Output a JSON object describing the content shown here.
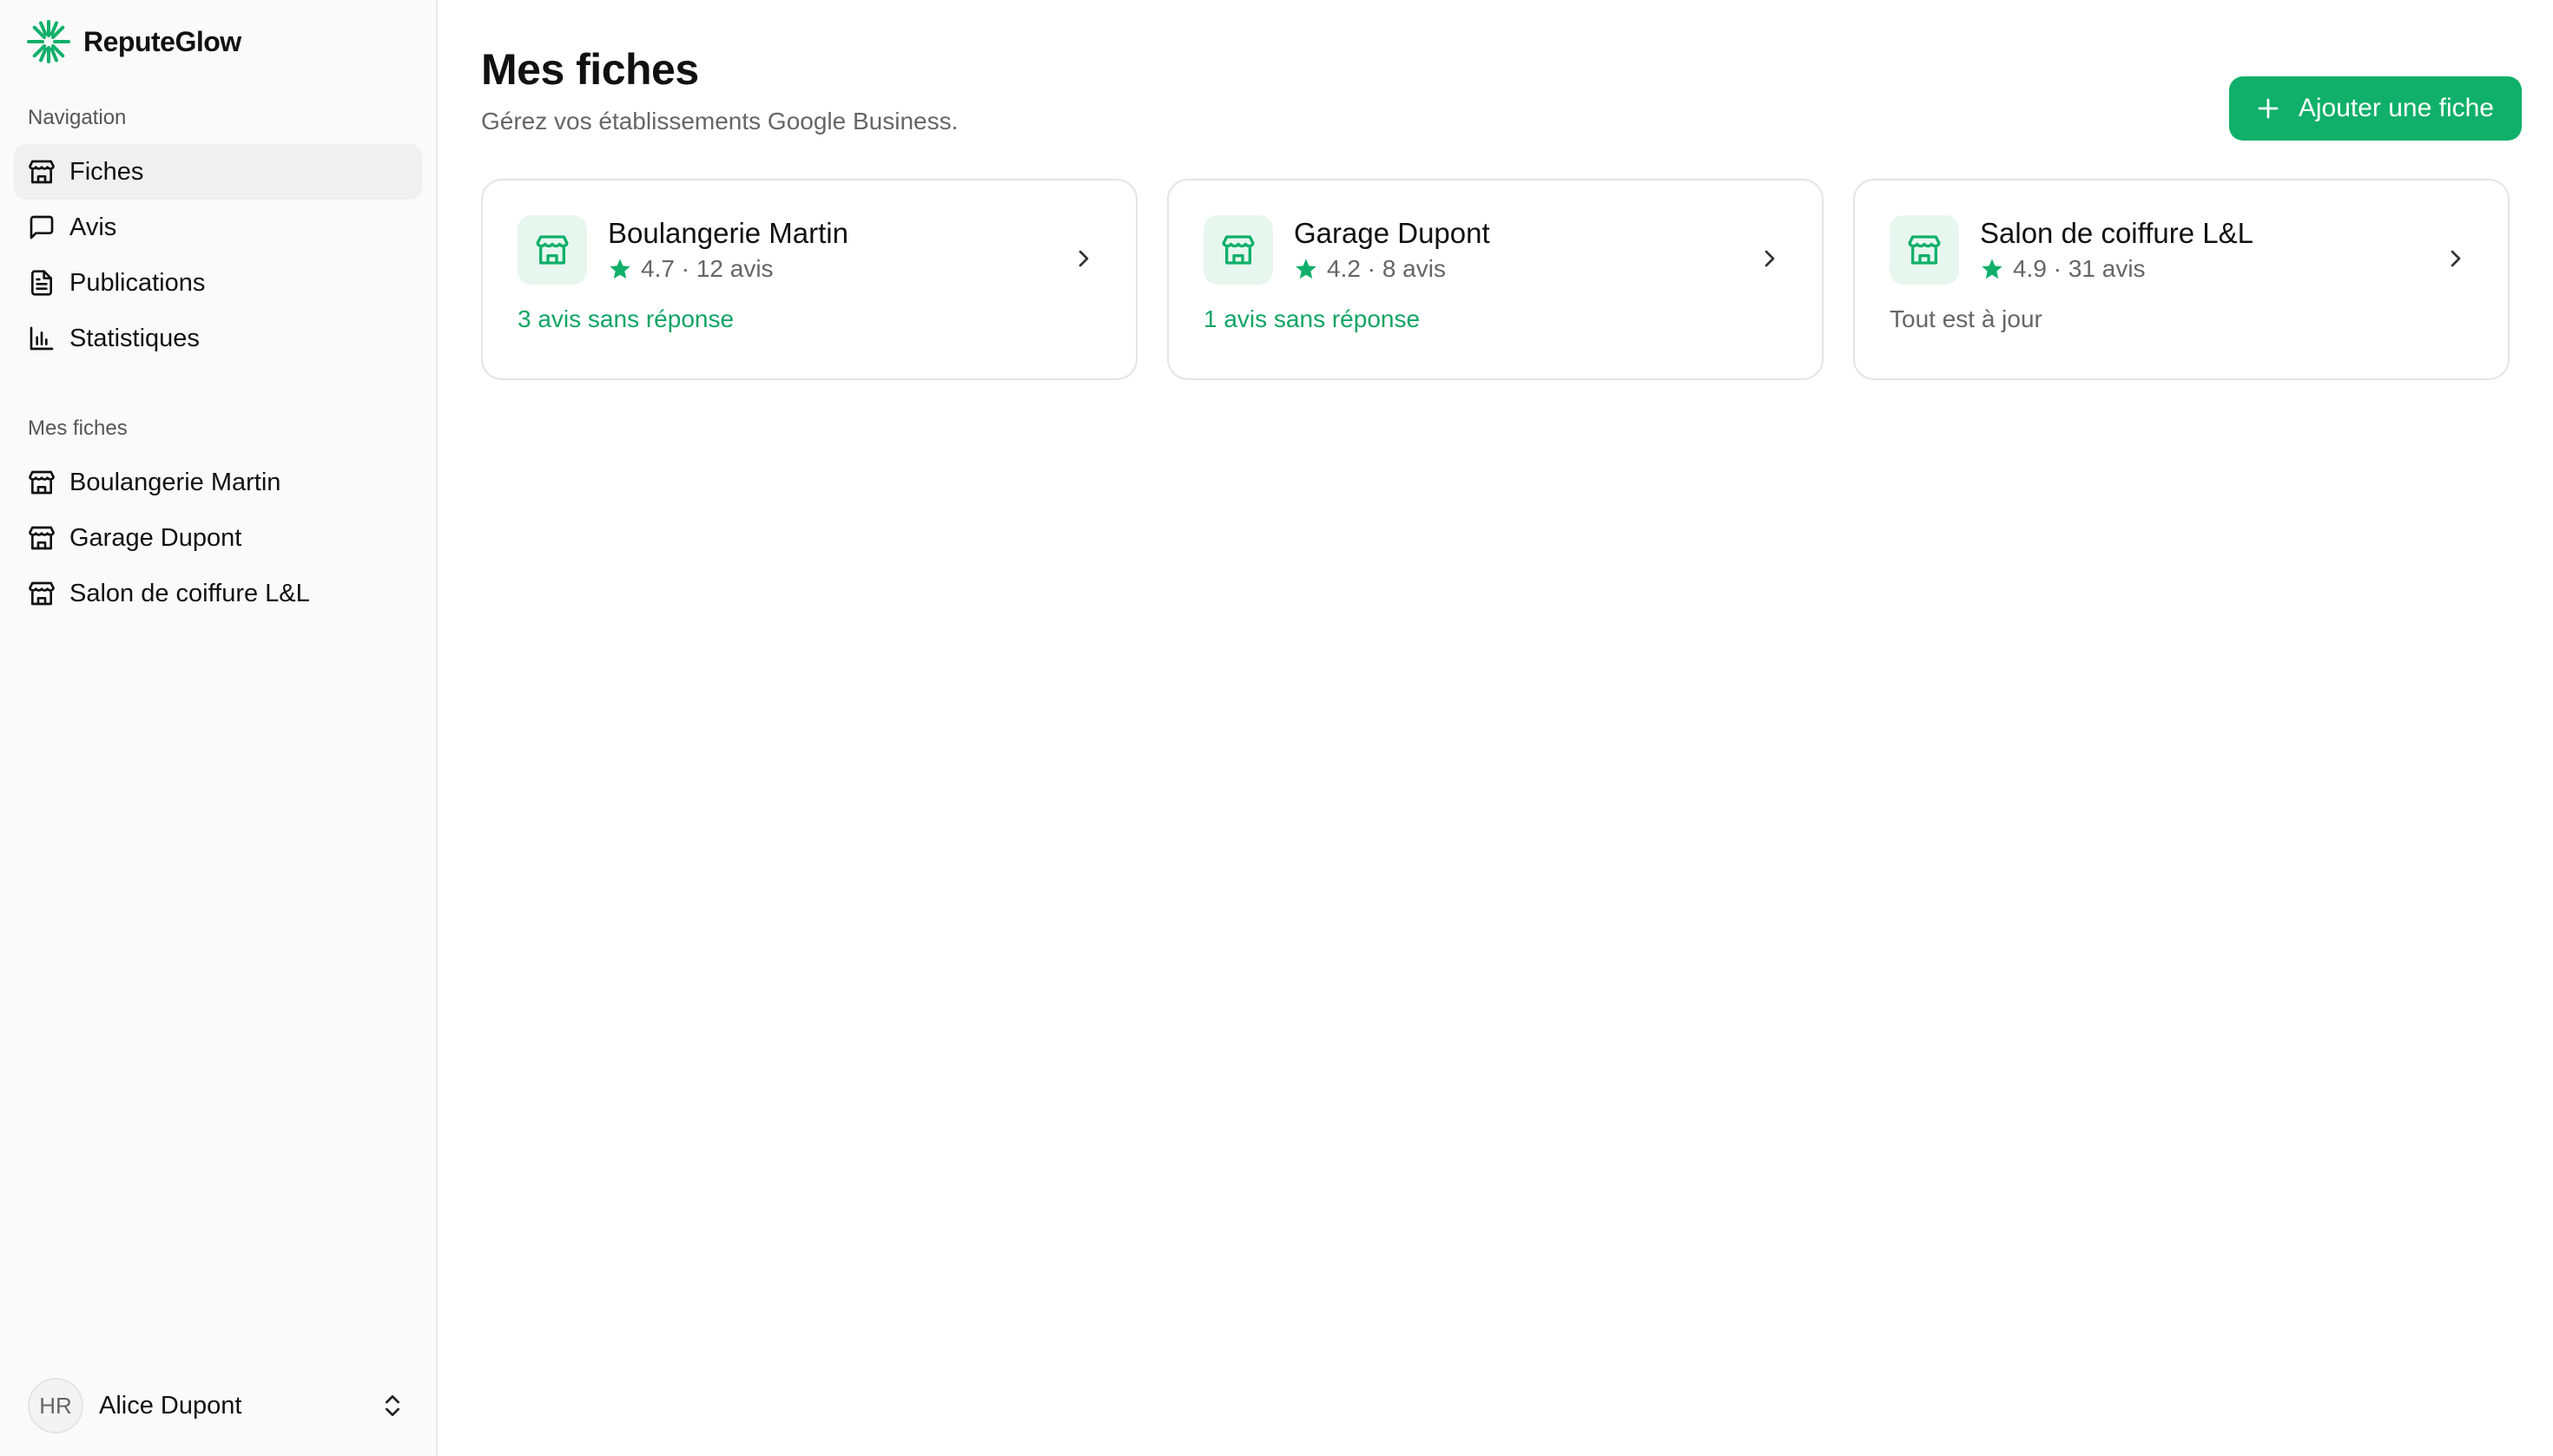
{
  "brand": {
    "name": "ReputeGlow",
    "accent": "#10b06a"
  },
  "sidebar": {
    "nav_label": "Navigation",
    "nav_items": [
      {
        "label": "Fiches",
        "icon": "store-icon",
        "active": true
      },
      {
        "label": "Avis",
        "icon": "message-square-icon",
        "active": false
      },
      {
        "label": "Publications",
        "icon": "file-text-icon",
        "active": false
      },
      {
        "label": "Statistiques",
        "icon": "bar-chart-icon",
        "active": false
      }
    ],
    "fiches_label": "Mes fiches",
    "fiches_items": [
      {
        "label": "Boulangerie Martin",
        "icon": "store-icon"
      },
      {
        "label": "Garage Dupont",
        "icon": "store-icon"
      },
      {
        "label": "Salon de coiffure L&L",
        "icon": "store-icon"
      }
    ],
    "user": {
      "initials": "HR",
      "name": "Alice Dupont"
    }
  },
  "main": {
    "title": "Mes fiches",
    "subtitle": "Gérez vos établissements Google Business.",
    "add_button": "Ajouter une fiche",
    "cards": [
      {
        "name": "Boulangerie Martin",
        "rating": "4.7",
        "separator": "·",
        "reviews": "12 avis",
        "status": "3 avis sans réponse",
        "status_type": "pending"
      },
      {
        "name": "Garage Dupont",
        "rating": "4.2",
        "separator": "·",
        "reviews": "8 avis",
        "status": "1 avis sans réponse",
        "status_type": "pending"
      },
      {
        "name": "Salon de coiffure L&L",
        "rating": "4.9",
        "separator": "·",
        "reviews": "31 avis",
        "status": "Tout est à jour",
        "status_type": "ok"
      }
    ]
  }
}
